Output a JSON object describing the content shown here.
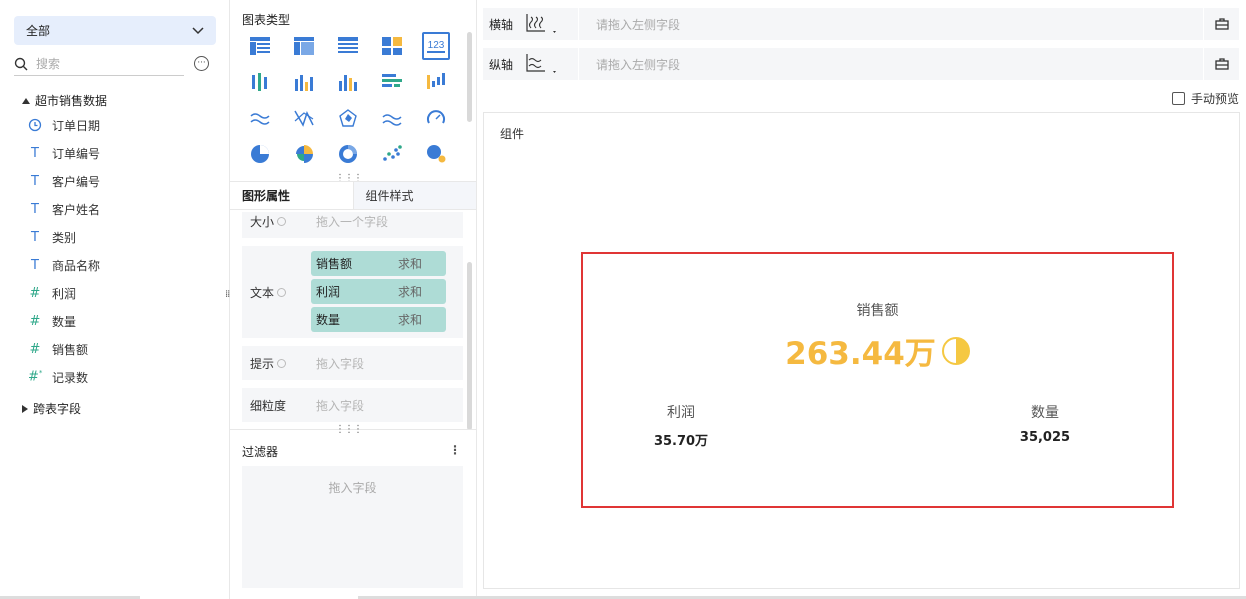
{
  "fields_panel": {
    "dropdown_label": "全部",
    "search_placeholder": "搜索",
    "group1": "超市销售数据",
    "fields": [
      {
        "icon": "clock-icon",
        "label": "订单日期"
      },
      {
        "icon": "text-type-icon",
        "label": "订单编号"
      },
      {
        "icon": "text-type-icon",
        "label": "客户编号"
      },
      {
        "icon": "text-type-icon",
        "label": "客户姓名"
      },
      {
        "icon": "text-type-icon",
        "label": "类别"
      },
      {
        "icon": "text-type-icon",
        "label": "商品名称"
      },
      {
        "icon": "number-type-icon",
        "label": "利润"
      },
      {
        "icon": "number-type-icon",
        "label": "数量"
      },
      {
        "icon": "number-type-icon",
        "label": "销售额"
      },
      {
        "icon": "record-count-icon",
        "label": "记录数"
      }
    ],
    "group2": "跨表字段"
  },
  "chart_types": {
    "title": "图表类型",
    "selected": "123"
  },
  "props_tabs": {
    "tab1": "图形属性",
    "tab2": "组件样式"
  },
  "props": {
    "size_label": "大小",
    "size_ph": "拖入一个字段",
    "text_label": "文本",
    "text_pills": [
      {
        "field": "销售额",
        "agg": "求和"
      },
      {
        "field": "利润",
        "agg": "求和"
      },
      {
        "field": "数量",
        "agg": "求和"
      }
    ],
    "tip_label": "提示",
    "tip_ph": "拖入字段",
    "gran_label": "细粒度",
    "gran_ph": "拖入字段"
  },
  "filter": {
    "title": "过滤器",
    "placeholder": "拖入字段"
  },
  "axes": {
    "x_label": "横轴",
    "x_ph": "请拖入左侧字段",
    "y_label": "纵轴",
    "y_ph": "请拖入左侧字段"
  },
  "manual_preview": "手动预览",
  "canvas": {
    "title": "组件",
    "main_label": "销售额",
    "main_value": "263.44万",
    "sub1_label": "利润",
    "sub1_value": "35.70万",
    "sub2_label": "数量",
    "sub2_value": "35,025"
  },
  "colors": {
    "accent": "#f5b940",
    "highlight": "#e03535",
    "pill": "#aedcd6",
    "chart_blue": "#3a7bd5"
  }
}
